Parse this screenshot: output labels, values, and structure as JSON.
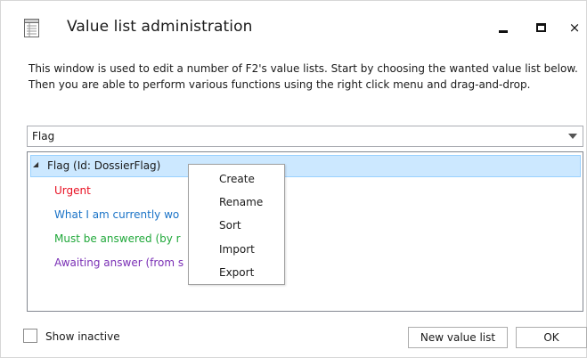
{
  "window": {
    "title": "Value list administration",
    "icon": "list-document-icon",
    "controls": {
      "minimize_icon": "minimize-icon",
      "maximize_icon": "maximize-icon",
      "close_label": "×"
    }
  },
  "description": "This window is used to edit a number of F2's value lists. Start by choosing the wanted value list below. Then you are able to perform various functions using the right click menu and drag-and-drop.",
  "value_list_select": {
    "selected": "Flag"
  },
  "tree": {
    "root": {
      "label": "Flag (Id: DossierFlag)",
      "expanded": true,
      "selected": true
    },
    "items": [
      {
        "label": "Urgent",
        "color": "#e81123"
      },
      {
        "label": "What I am currently wo",
        "color": "#1a73c7"
      },
      {
        "label": "Must be answered (by r",
        "color": "#20a83a"
      },
      {
        "label": "Awaiting answer (from s",
        "color": "#7a2fb5"
      }
    ]
  },
  "context_menu": {
    "items": [
      {
        "label": "Create"
      },
      {
        "label": "Rename"
      },
      {
        "label": "Sort"
      },
      {
        "label": "Import"
      },
      {
        "label": "Export"
      }
    ]
  },
  "footer": {
    "show_inactive_label": "Show inactive",
    "show_inactive_checked": false,
    "new_value_list_label": "New value list",
    "ok_label": "OK"
  },
  "colors": {
    "selection_bg": "#cce8ff",
    "selection_border": "#99d1ff"
  }
}
